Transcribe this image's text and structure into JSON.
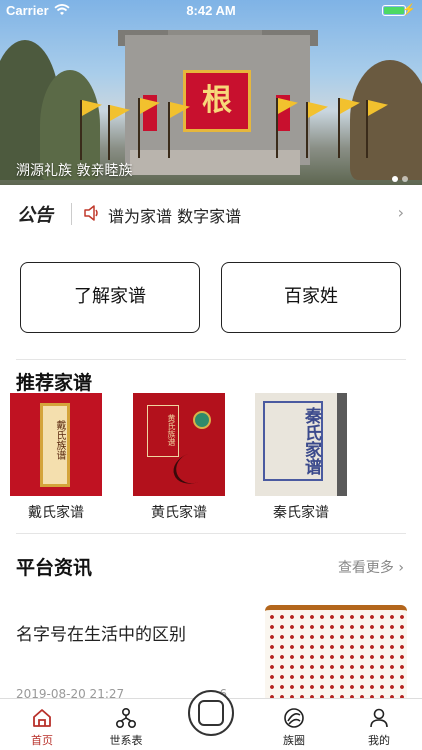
{
  "status_bar": {
    "carrier": "Carrier",
    "time": "8:42 AM"
  },
  "banner": {
    "caption": "溯源礼族 敦亲睦族",
    "plaque_char": "根",
    "slide_count": 2,
    "active_slide": 1
  },
  "notice": {
    "title": "公告",
    "text": "谱为家谱 数字家谱",
    "icon": "speaker-icon"
  },
  "quick_actions": {
    "left": "了解家谱",
    "right": "百家姓"
  },
  "recommended": {
    "title": "推荐家谱",
    "books": [
      {
        "label": "戴氏家谱",
        "cover_text": "戴氏族谱"
      },
      {
        "label": "黄氏家谱",
        "cover_text": "黄氏族谱"
      },
      {
        "label": "秦氏家谱",
        "cover_text": "秦氏家谱"
      }
    ]
  },
  "news": {
    "title": "平台资讯",
    "more_label": "查看更多",
    "items": [
      {
        "headline": "名字号在生活中的区别",
        "date": "2019-08-20 21:27",
        "views": "6"
      }
    ]
  },
  "tabbar": {
    "items": [
      {
        "label": "首页",
        "icon": "home-icon",
        "active": true
      },
      {
        "label": "世系表",
        "icon": "family-tree-icon",
        "active": false
      },
      {
        "label": "",
        "icon": "book-icon",
        "active": false
      },
      {
        "label": "族圈",
        "icon": "circle-icon",
        "active": false
      },
      {
        "label": "我的",
        "icon": "user-icon",
        "active": false
      }
    ]
  },
  "colors": {
    "accent": "#b8302a",
    "banner_red": "#c8102e",
    "battery": "#4cd964"
  }
}
